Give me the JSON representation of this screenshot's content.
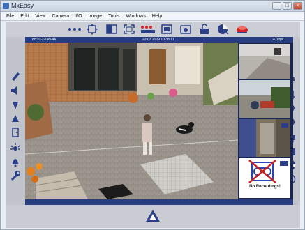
{
  "window": {
    "title": "MxEasy",
    "buttons": [
      "min",
      "max",
      "close"
    ]
  },
  "menu": [
    "File",
    "Edit",
    "View",
    "Camera",
    "I/O",
    "Image",
    "Tools",
    "Windows",
    "Help"
  ],
  "toolbar": {
    "icons": [
      "more-dots-icon",
      "pan-icon",
      "layout-icon",
      "fullscreen-icon",
      "sequence-icon",
      "recording-icon",
      "snapshot-icon",
      "lock-icon",
      "audio-icon",
      "alarm-icon"
    ],
    "alarm_color": "#d8232a"
  },
  "camera_header": {
    "name": "mx10-2-149-44",
    "datetime": "22.07.2009 10:33:11",
    "framerate": "4.0 fps"
  },
  "left_tools": [
    "brush-icon",
    "speaker-icon",
    "down-triangle-icon",
    "up-triangle-icon",
    "door-icon",
    "light-icon",
    "bell-icon",
    "wrench-icon"
  ],
  "right_tools": [
    "settings-gear-icon",
    "crop-icon",
    "motion-icon",
    "playback-icon",
    "print-icon",
    "camera-icon",
    "help-ring-icon",
    "info-icon"
  ],
  "thumbnails": {
    "no_recording_text": "No Recordings!",
    "no_recording_color": "#2a45b8",
    "cross_color": "#cc2222"
  },
  "colors": {
    "accent": "#273d80",
    "frame": "#c1c4ca"
  }
}
